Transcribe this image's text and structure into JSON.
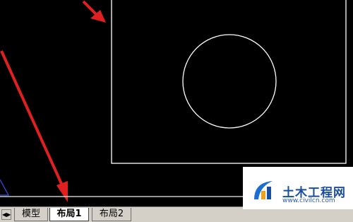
{
  "tabs": {
    "nav_label": "◀▶",
    "model": "模型",
    "layout1": "布局1",
    "layout2": "布局2",
    "active": "布局1"
  },
  "watermark": {
    "title": "土木工程网",
    "url": "www.civilcn.com"
  },
  "colors": {
    "background": "#000000",
    "drawing": "#ffffff",
    "annotation_arrow": "#e02020",
    "ucs_icon": "#3040c0"
  },
  "icons": [
    "arrow-annotation-icon",
    "ucs-icon",
    "civilcn-logo-icon"
  ]
}
